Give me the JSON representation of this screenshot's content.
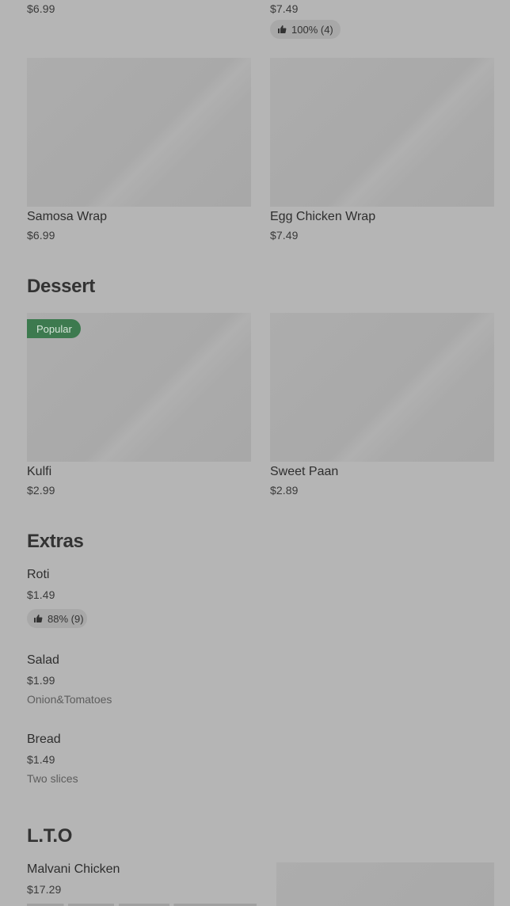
{
  "wraps_top": [
    {
      "price": "$6.99"
    },
    {
      "price": "$7.49",
      "rating": "100% (4)"
    }
  ],
  "wraps": [
    {
      "name": "Samosa Wrap",
      "price": "$6.99"
    },
    {
      "name": "Egg Chicken Wrap",
      "price": "$7.49"
    }
  ],
  "dessert": {
    "title": "Dessert",
    "items": [
      {
        "name": "Kulfi",
        "price": "$2.99",
        "badge": "Popular"
      },
      {
        "name": "Sweet Paan",
        "price": "$2.89"
      }
    ]
  },
  "extras": {
    "title": "Extras",
    "items": [
      {
        "name": "Roti",
        "price": "$1.49",
        "rating": "88% (9)"
      },
      {
        "name": "Salad",
        "price": "$1.99",
        "description": "Onion&Tomatoes"
      },
      {
        "name": "Bread",
        "price": "$1.49",
        "description": "Two slices"
      }
    ]
  },
  "lto": {
    "title": "L.T.O",
    "items": [
      {
        "name": "Malvani Chicken",
        "price": "$17.29"
      }
    ]
  },
  "icons": {
    "rating": "thumbs-up-icon"
  },
  "colors": {
    "background": "#b5b5b5",
    "badge": "#3d7a4f",
    "pill": "#a8a8a8"
  }
}
